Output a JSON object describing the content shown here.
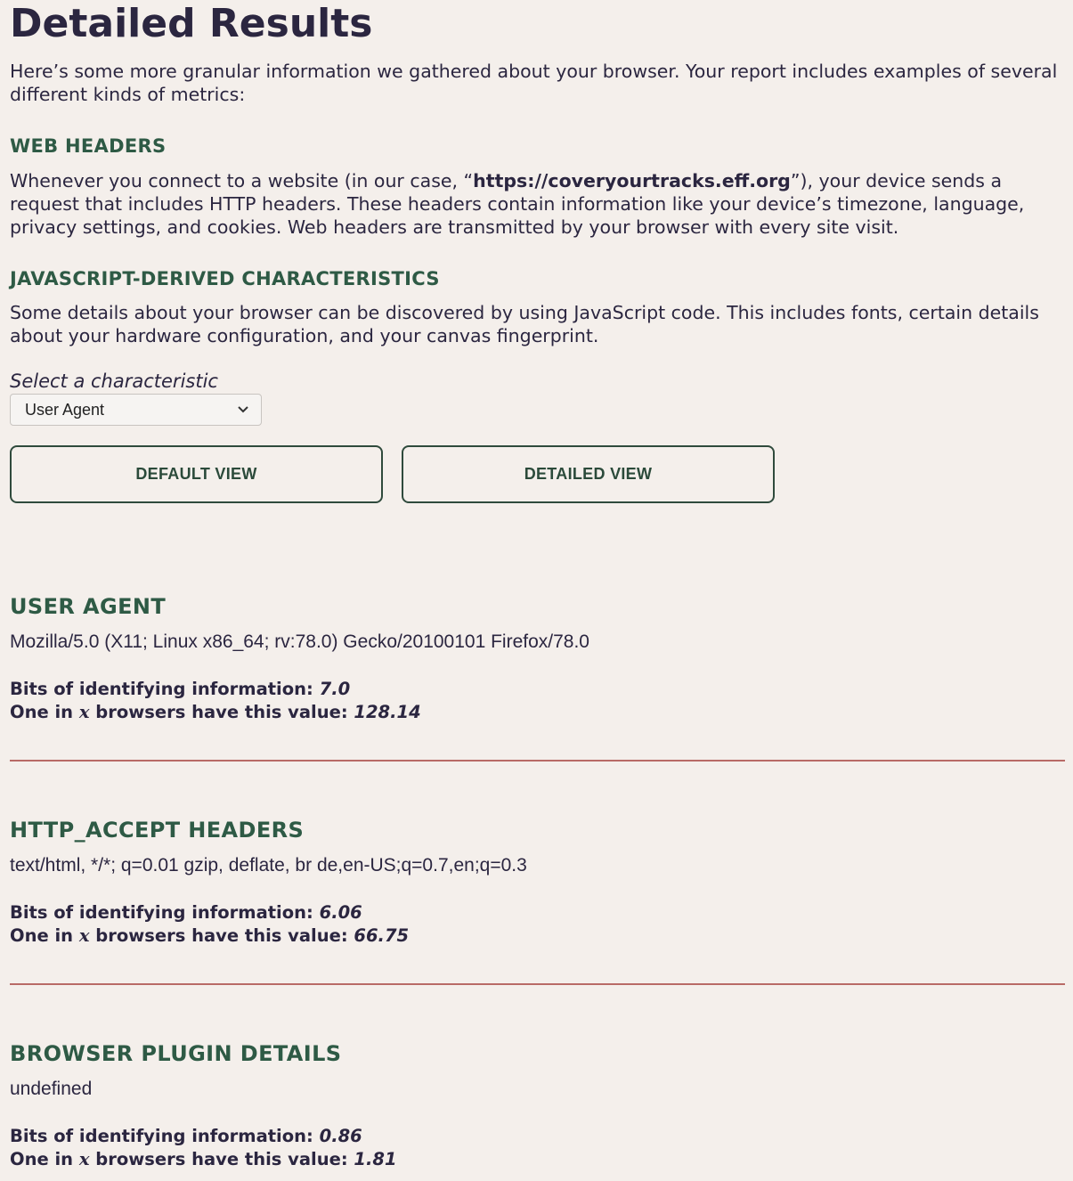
{
  "page_title": "Detailed Results",
  "intro": "Here’s some more granular information we gathered about your browser. Your report includes examples of several different kinds of metrics:",
  "sections": {
    "web_headers": {
      "heading": "WEB HEADERS",
      "text_before": "Whenever you connect to a website (in our case, “",
      "link": "https://coveryourtracks.eff.org",
      "text_after": "”), your device sends a request that includes HTTP headers. These headers contain information like your device’s timezone, language, privacy settings, and cookies. Web headers are transmitted by your browser with every site visit."
    },
    "js_characteristics": {
      "heading": "JAVASCRIPT-DERIVED CHARACTERISTICS",
      "text": "Some details about your browser can be discovered by using JavaScript code. This includes fonts, certain details about your hardware configuration, and your canvas fingerprint."
    }
  },
  "select": {
    "label": "Select a characteristic",
    "value": "User Agent"
  },
  "buttons": {
    "default_view": "DEFAULT VIEW",
    "detailed_view": "DETAILED VIEW"
  },
  "stat_labels": {
    "bits_label": "Bits of identifying information:",
    "one_in_prefix": "One in",
    "x": "x",
    "one_in_suffix": "browsers have this value:"
  },
  "results": [
    {
      "title": "USER AGENT",
      "value": "Mozilla/5.0 (X11; Linux x86_64; rv:78.0) Gecko/20100101 Firefox/78.0",
      "bits": "7.0",
      "one_in": "128.14"
    },
    {
      "title": "HTTP_ACCEPT HEADERS",
      "value": "text/html, */*; q=0.01 gzip, deflate, br de,en-US;q=0.7,en;q=0.3",
      "bits": "6.06",
      "one_in": "66.75"
    },
    {
      "title": "BROWSER PLUGIN DETAILS",
      "value": "undefined",
      "bits": "0.86",
      "one_in": "1.81"
    }
  ],
  "colors": {
    "background": "#f4efeb",
    "heading_green": "#2e5a45",
    "text_dark": "#2b2640",
    "divider": "#b86a66"
  }
}
